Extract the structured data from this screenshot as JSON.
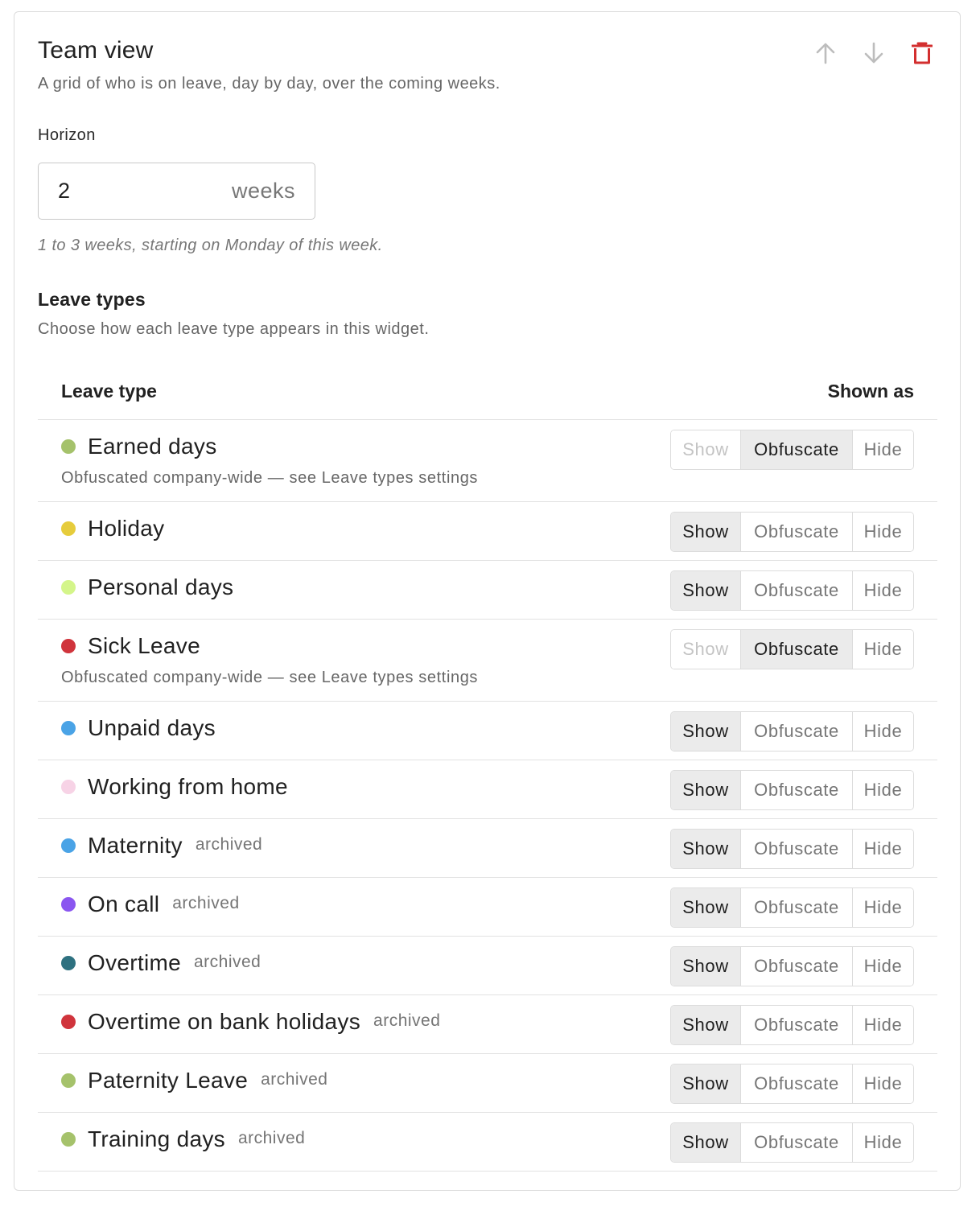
{
  "header": {
    "title": "Team view",
    "subtitle": "A grid of who is on leave, day by day, over the coming weeks.",
    "actions": [
      {
        "name": "move-up",
        "icon": "arrow-up-icon",
        "color": "#bdbdbd"
      },
      {
        "name": "move-down",
        "icon": "arrow-down-icon",
        "color": "#bdbdbd"
      },
      {
        "name": "delete",
        "icon": "trash-icon",
        "color": "#d32f2f"
      }
    ]
  },
  "horizon": {
    "label": "Horizon",
    "value": "2",
    "unit": "weeks",
    "hint": "1 to 3 weeks, starting on Monday of this week."
  },
  "leave_types_section": {
    "title": "Leave types",
    "subtitle": "Choose how each leave type appears in this widget.",
    "column_left": "Leave type",
    "column_right": "Shown as",
    "option_labels": {
      "show": "Show",
      "obfuscate": "Obfuscate",
      "hide": "Hide"
    },
    "rows": [
      {
        "name": "Earned days",
        "color": "#a5c26b",
        "archived": "",
        "note": "Obfuscated company-wide — see Leave types settings",
        "selected": "obfuscate",
        "show_disabled": true
      },
      {
        "name": "Holiday",
        "color": "#e6cc3c",
        "archived": "",
        "note": "",
        "selected": "show",
        "show_disabled": false
      },
      {
        "name": "Personal days",
        "color": "#d4f58a",
        "archived": "",
        "note": "",
        "selected": "show",
        "show_disabled": false
      },
      {
        "name": "Sick Leave",
        "color": "#d0343c",
        "archived": "",
        "note": "Obfuscated company-wide — see Leave types settings",
        "selected": "obfuscate",
        "show_disabled": true
      },
      {
        "name": "Unpaid days",
        "color": "#4aa3e6",
        "archived": "",
        "note": "",
        "selected": "show",
        "show_disabled": false
      },
      {
        "name": "Working from home",
        "color": "#f7d3e6",
        "archived": "",
        "note": "",
        "selected": "show",
        "show_disabled": false
      },
      {
        "name": "Maternity",
        "color": "#4aa3e6",
        "archived": "archived",
        "note": "",
        "selected": "show",
        "show_disabled": false
      },
      {
        "name": "On call",
        "color": "#8a56f0",
        "archived": "archived",
        "note": "",
        "selected": "show",
        "show_disabled": false
      },
      {
        "name": "Overtime",
        "color": "#2e7180",
        "archived": "archived",
        "note": "",
        "selected": "show",
        "show_disabled": false
      },
      {
        "name": "Overtime on bank holidays",
        "color": "#d0343c",
        "archived": "archived",
        "note": "",
        "selected": "show",
        "show_disabled": false
      },
      {
        "name": "Paternity Leave",
        "color": "#a5c26b",
        "archived": "archived",
        "note": "",
        "selected": "show",
        "show_disabled": false
      },
      {
        "name": "Training days",
        "color": "#a5c26b",
        "archived": "archived",
        "note": "",
        "selected": "show",
        "show_disabled": false
      }
    ]
  }
}
